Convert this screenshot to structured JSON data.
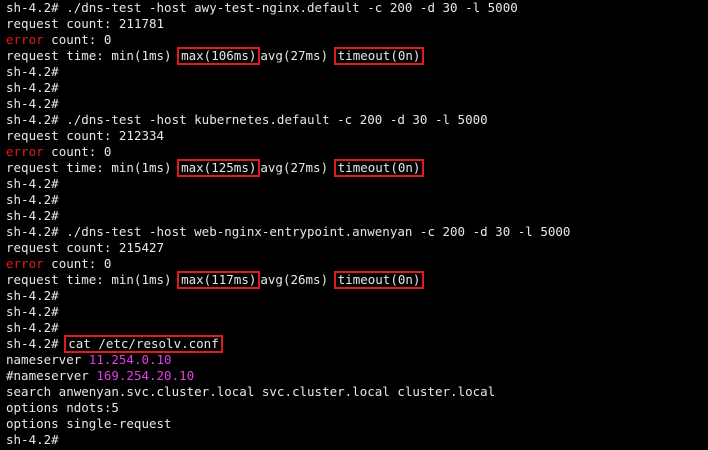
{
  "terminal": {
    "prompt": "sh-4.2#",
    "block1": {
      "command": " ./dns-test -host awy-test-nginx.default -c 200 -d 30 -l 5000",
      "request_count_label": "request count: ",
      "request_count": "211781",
      "error_label": "error",
      "error_rest": " count: 0",
      "rt_label": "request time: ",
      "min": "min(1ms)",
      "max": "max(106ms)",
      "avg": "avg(27ms)",
      "timeout": "timeout(0n)"
    },
    "block2": {
      "command": " ./dns-test -host kubernetes.default -c 200 -d 30 -l 5000",
      "request_count_label": "request count: ",
      "request_count": "212334",
      "error_label": "error",
      "error_rest": " count: 0",
      "rt_label": "request time: ",
      "min": "min(1ms)",
      "max": "max(125ms)",
      "avg": "avg(27ms)",
      "timeout": "timeout(0n)"
    },
    "block3": {
      "command": " ./dns-test -host web-nginx-entrypoint.anwenyan -c 200 -d 30 -l 5000",
      "request_count_label": "request count: ",
      "request_count": "215427",
      "error_label": "error",
      "error_rest": " count: 0",
      "rt_label": "request time: ",
      "min": "min(1ms)",
      "max": "max(117ms)",
      "avg": "avg(26ms)",
      "timeout": "timeout(0n)"
    },
    "resolv": {
      "command": "cat /etc/resolv.conf",
      "ns_label": "nameserver ",
      "ns_value": "11.254.0.10",
      "ns2_label": "#nameserver ",
      "ns2_value": "169.254.20.10",
      "search": "search anwenyan.svc.cluster.local svc.cluster.local cluster.local",
      "options1": "options ndots:5",
      "options2": "options single-request"
    },
    "colors": {
      "background": "#000000",
      "text": "#e8e8e8",
      "error": "#e01b1b",
      "highlight_box": "#e01b1b",
      "ip": "#e040e0"
    }
  }
}
